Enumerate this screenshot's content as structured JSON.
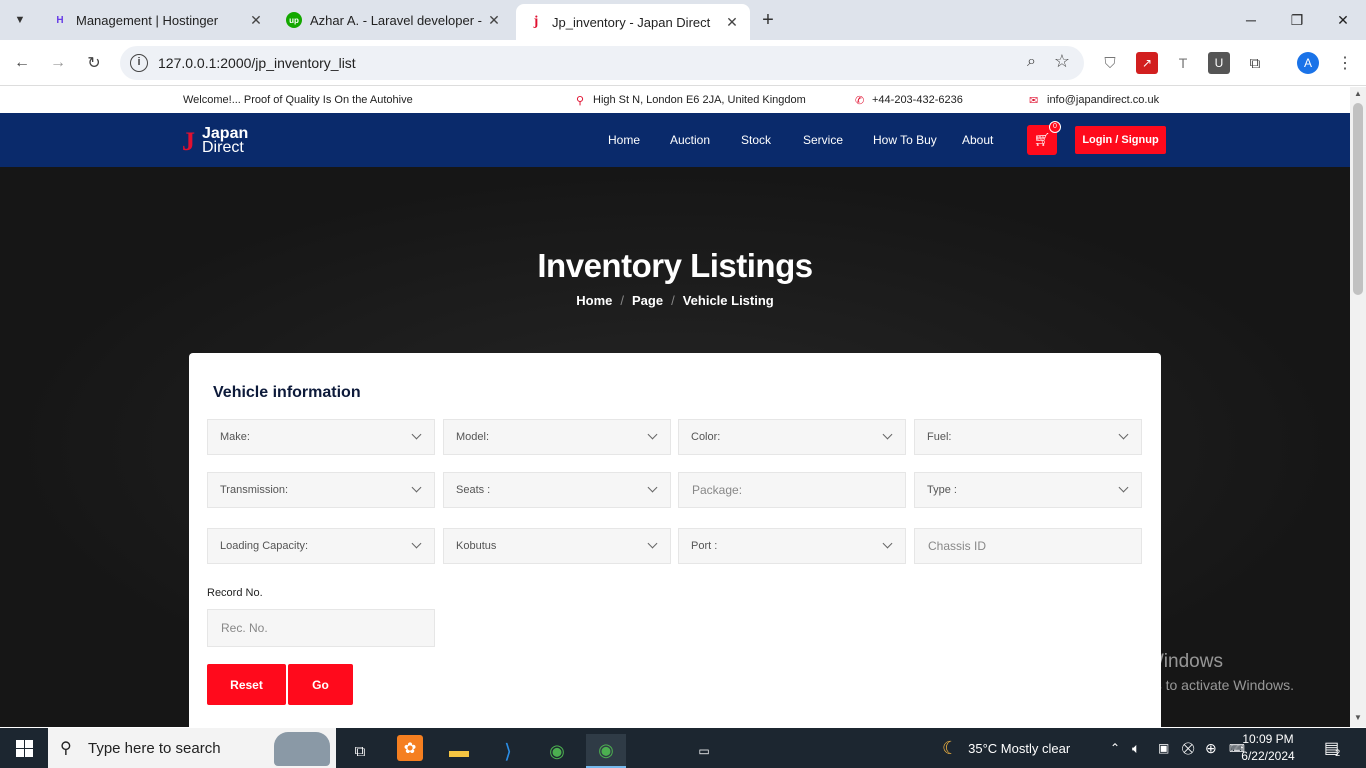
{
  "browser": {
    "tabs": [
      {
        "title": "Management | Hostinger",
        "favicon": "H"
      },
      {
        "title": "Azhar A. - Laravel developer - U",
        "favicon": "up"
      },
      {
        "title": "Jp_inventory - Japan Direct",
        "favicon": "j"
      }
    ],
    "url": "127.0.0.1:2000/jp_inventory_list",
    "profile_initial": "A"
  },
  "topinfo": {
    "welcome": "Welcome!... Proof of Quality Is On the Autohive",
    "address": "High St N, London E6 2JA, United Kingdom",
    "phone": "+44-203-432-6236",
    "email": "info@japandirect.co.uk"
  },
  "logo": {
    "line1": "Japan",
    "line2": "Direct",
    "mark": "J"
  },
  "nav": {
    "links": [
      "Home",
      "Auction",
      "Stock",
      "Service",
      "How To Buy",
      "About"
    ],
    "cart_count": "0",
    "login": "Login / Signup"
  },
  "hero": {
    "title": "Inventory Listings",
    "breadcrumb": [
      "Home",
      "Page",
      "Vehicle Listing"
    ]
  },
  "form": {
    "heading": "Vehicle information",
    "selects": {
      "make": "Make:",
      "model": "Model:",
      "color": "Color:",
      "fuel": "Fuel:",
      "transmission": "Transmission:",
      "seats": "Seats :",
      "type": "Type :",
      "loading": "Loading Capacity:",
      "kobutus": "Kobutus",
      "port": "Port :"
    },
    "inputs": {
      "package_placeholder": "Package:",
      "chassis_placeholder": "Chassis ID",
      "record_label": "Record No.",
      "record_placeholder": "Rec. No."
    },
    "reset": "Reset",
    "go": "Go"
  },
  "watermark": {
    "line1": "Activate Windows",
    "line2": "Go to Settings to activate Windows."
  },
  "taskbar": {
    "search": "Type here to search",
    "weather": "35°C  Mostly clear",
    "time": "10:09 PM",
    "date": "6/22/2024",
    "notifications": "2"
  }
}
